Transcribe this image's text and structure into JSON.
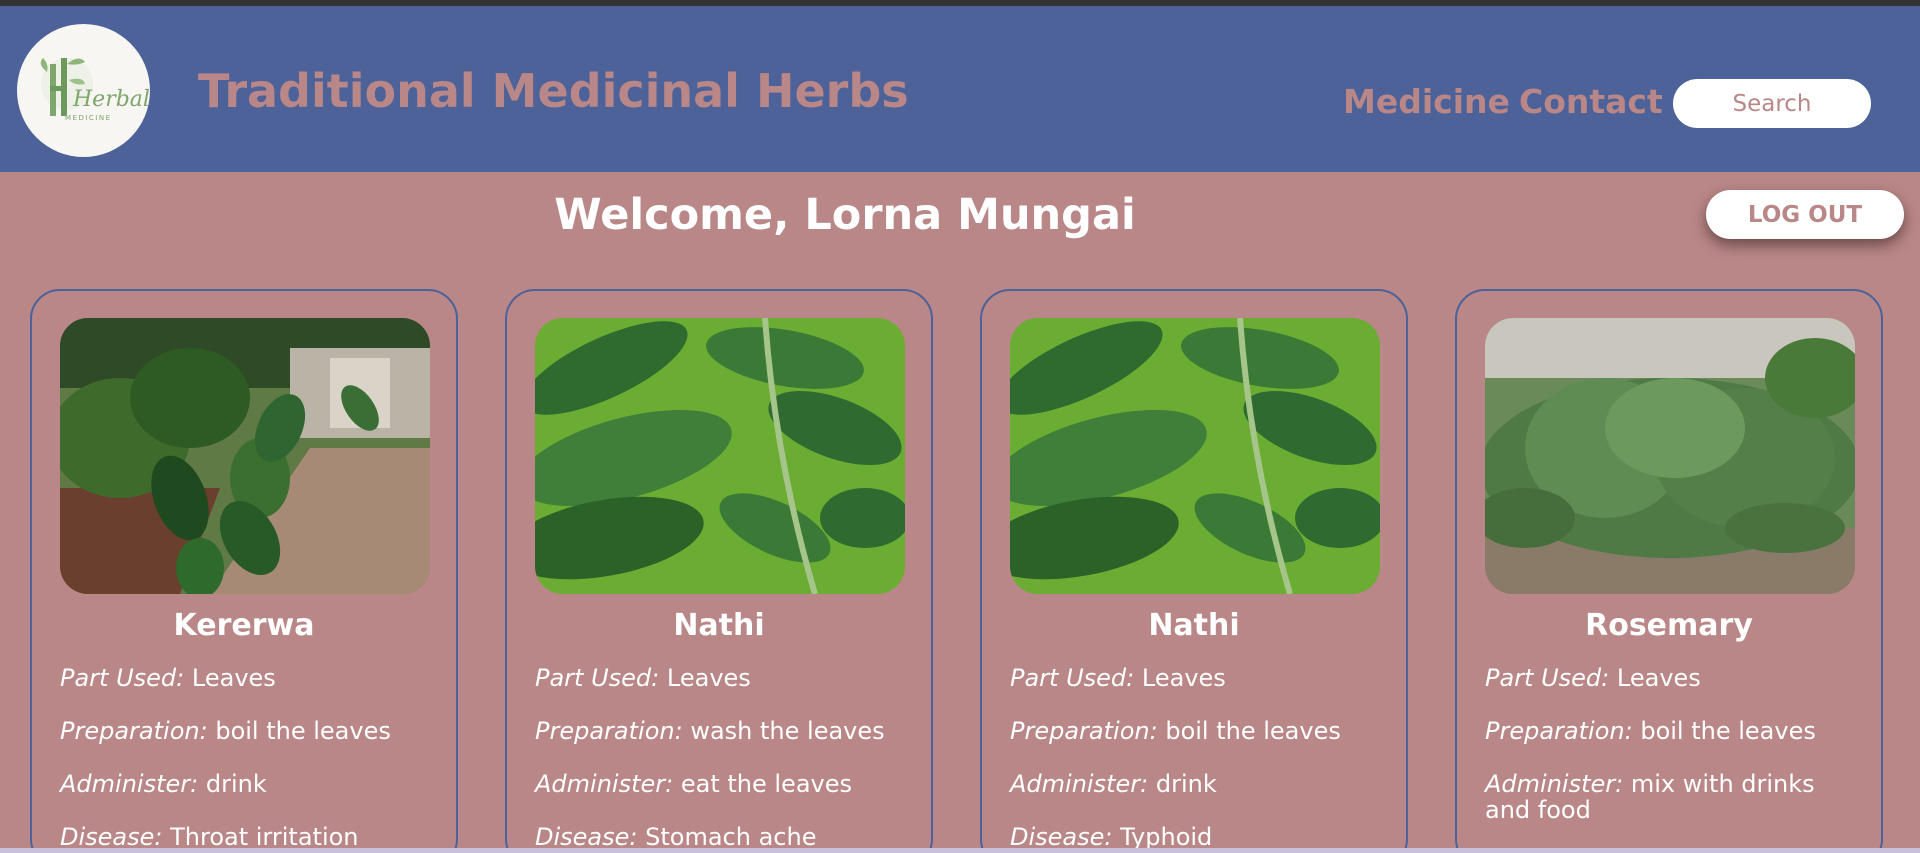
{
  "header": {
    "logo_text": "Herbal",
    "logo_subtext": "MEDICINE",
    "title": "Traditional Medicinal Herbs",
    "nav": [
      {
        "label": "Medicine"
      },
      {
        "label": "Contact"
      }
    ],
    "search_placeholder": "Search"
  },
  "welcome": "Welcome, Lorna Mungai",
  "logout_label": "LOG OUT",
  "labels": {
    "part": "Part Used:",
    "prep": "Preparation:",
    "admin": "Administer:",
    "disease": "Disease:"
  },
  "cards": [
    {
      "name": "Kererwa",
      "part": "Leaves",
      "prep": "boil the leaves",
      "admin": "drink",
      "disease": "Throat irritation"
    },
    {
      "name": "Nathi",
      "part": "Leaves",
      "prep": "wash the leaves",
      "admin": "eat the leaves",
      "disease": "Stomach ache"
    },
    {
      "name": "Nathi",
      "part": "Leaves",
      "prep": "boil the leaves",
      "admin": "drink",
      "disease": "Typhoid"
    },
    {
      "name": "Rosemary",
      "part": "Leaves",
      "prep": "boil the leaves",
      "admin": "mix with drinks and food",
      "disease": ""
    }
  ],
  "colors": {
    "header_bg": "#4c6298",
    "page_bg": "#b98787",
    "accent_text": "#b98787"
  }
}
